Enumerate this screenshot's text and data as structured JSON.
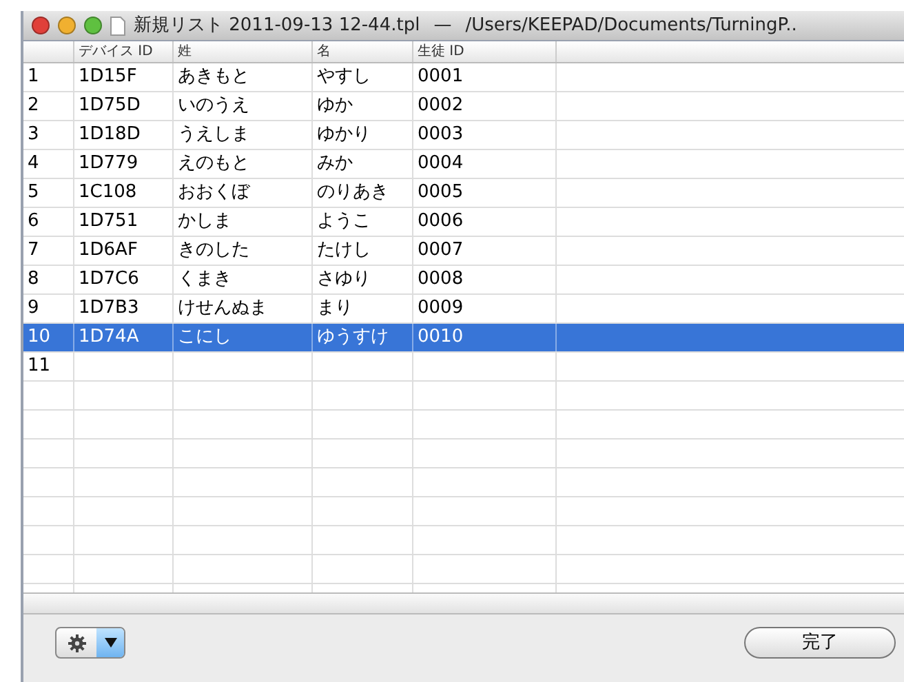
{
  "window": {
    "title": "新規リスト 2011-09-13 12-44.tpl",
    "path": "/Users/KEEPAD/Documents/TurningP..",
    "separator": "—"
  },
  "table": {
    "columns": [
      "",
      "デバイス ID",
      "姓",
      "名",
      "生徒 ID"
    ],
    "rows": [
      {
        "cells": [
          "1",
          "1D15F",
          "あきもと",
          "やすし",
          "0001"
        ],
        "selected": false
      },
      {
        "cells": [
          "2",
          "1D75D",
          "いのうえ",
          "ゆか",
          "0002"
        ],
        "selected": false
      },
      {
        "cells": [
          "3",
          "1D18D",
          "うえしま",
          "ゆかり",
          "0003"
        ],
        "selected": false
      },
      {
        "cells": [
          "4",
          "1D779",
          "えのもと",
          "みか",
          "0004"
        ],
        "selected": false
      },
      {
        "cells": [
          "5",
          "1C108",
          "おおくぼ",
          "のりあき",
          "0005"
        ],
        "selected": false
      },
      {
        "cells": [
          "6",
          "1D751",
          "かしま",
          "ようこ",
          "0006"
        ],
        "selected": false
      },
      {
        "cells": [
          "7",
          "1D6AF",
          "きのした",
          "たけし",
          "0007"
        ],
        "selected": false
      },
      {
        "cells": [
          "8",
          "1D7C6",
          "くまき",
          "さゆり",
          "0008"
        ],
        "selected": false
      },
      {
        "cells": [
          "9",
          "1D7B3",
          "けせんぬま",
          "まり",
          "0009"
        ],
        "selected": false
      },
      {
        "cells": [
          "10",
          "1D74A",
          "こにし",
          "ゆうすけ",
          "0010"
        ],
        "selected": true
      },
      {
        "cells": [
          "11",
          "",
          "",
          "",
          ""
        ],
        "selected": false
      }
    ]
  },
  "buttons": {
    "done": "完了"
  }
}
